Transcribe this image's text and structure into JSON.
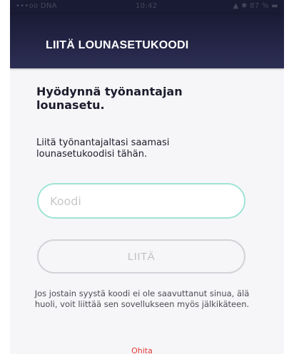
{
  "status_bar": {
    "left": "•••oo DNA",
    "time": "10:42",
    "right": "▲ ✱ 87 % ▬"
  },
  "header": {
    "title": "LIITÄ LOUNASETUKOODI"
  },
  "content": {
    "heading": "Hyödynnä työnantajan lounasetu.",
    "instruction": "Liitä työnantajaltasi saamasi lounasetukoodisi tähän.",
    "code_field": {
      "placeholder": "Koodi",
      "value": ""
    },
    "attach_button_label": "LIITÄ",
    "note": "Jos jostain syystä koodi ei ole saavuttanut sinua, älä huoli, voit liittää sen sovellukseen myös jälkikäteen.",
    "skip_label": "Ohita"
  },
  "colors": {
    "header_bg": "#1a1b35",
    "input_border": "#9fe4d5",
    "skip": "#e03a3a"
  }
}
